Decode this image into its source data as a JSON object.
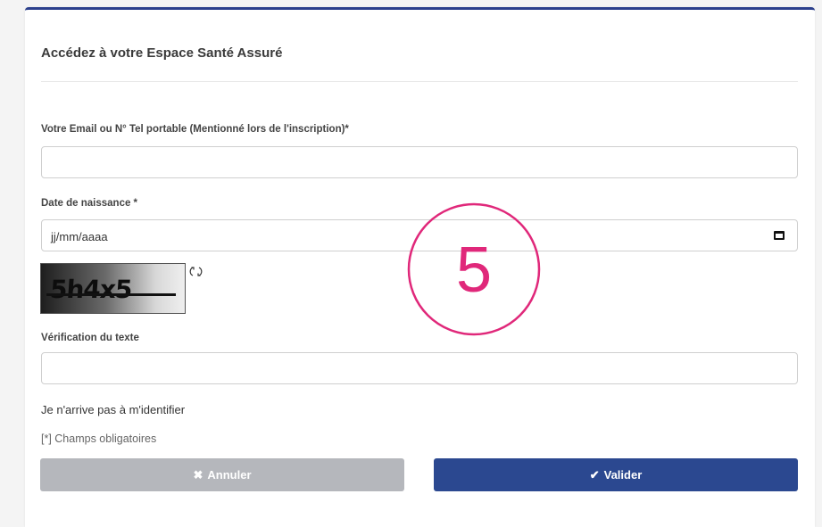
{
  "form": {
    "title": "Accédez à votre Espace Santé Assuré",
    "email_label": "Votre Email ou N° Tel portable (Mentionné lors de l'inscription)*",
    "email_value": "",
    "dob_label": "Date de naissance *",
    "dob_value": "jj/mm/aaaa",
    "captcha_text": "5h4x5",
    "verification_label": "Vérification du texte",
    "verification_value": "",
    "forgot_link": "Je n'arrive pas à m'identifier",
    "required_hint": "[*] Champs obligatoires",
    "cancel_label": "Annuler",
    "submit_label": "Valider"
  },
  "overlay": {
    "step_number": "5",
    "color": "#e0287a"
  },
  "icons": {
    "calendar": "calendar-icon",
    "refresh": "refresh-icon",
    "cancel": "x-icon",
    "submit": "checkmark-icon"
  },
  "colors": {
    "accent": "#2b4890",
    "cancel_button": "#b5b7bc",
    "top_border": "#2b3f8c"
  }
}
